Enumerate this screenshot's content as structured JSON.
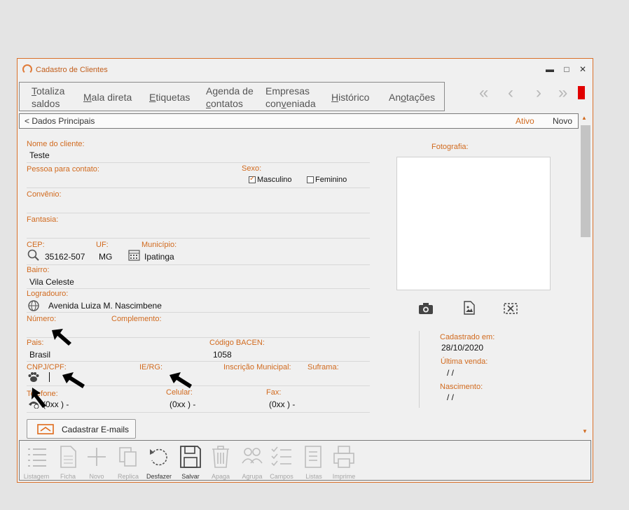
{
  "window": {
    "title": "Cadastro de Clientes",
    "controls": {
      "minimize": "▬",
      "maximize": "□",
      "close": "✕"
    }
  },
  "menu": [
    {
      "line1_pre": "",
      "line1_u": "T",
      "line1_post": "otaliza",
      "line2": "saldos"
    },
    {
      "line1_pre": "",
      "line1_u": "M",
      "line1_post": "ala direta",
      "line2": ""
    },
    {
      "line1_pre": "",
      "line1_u": "E",
      "line1_post": "tiquetas",
      "line2": ""
    },
    {
      "line1": "Agenda de",
      "line2_pre": "",
      "line2_u": "c",
      "line2_post": "ontatos"
    },
    {
      "line1": "Empresas",
      "line2_pre": "con",
      "line2_u": "v",
      "line2_post": "eniada"
    },
    {
      "line1_pre": "",
      "line1_u": "H",
      "line1_post": "istórico",
      "line2": ""
    },
    {
      "line1_pre": "An",
      "line1_u": "o",
      "line1_post": "tações",
      "line2": ""
    }
  ],
  "nav": {
    "first": "«",
    "prev": "‹",
    "next": "›",
    "last": "»",
    "indicator_color": "#e10000"
  },
  "section": {
    "title": "< Dados Principais",
    "status": "Ativo",
    "mode": "Novo"
  },
  "form": {
    "nome_label": "Nome do cliente:",
    "nome_value": "Teste",
    "contato_label": "Pessoa para contato:",
    "sexo_label": "Sexo:",
    "sexo_masculino": "Masculino",
    "sexo_feminino": "Feminino",
    "sexo_selected": "Masculino",
    "convenio_label": "Convênio:",
    "fantasia_label": "Fantasia:",
    "cep_label": "CEP:",
    "cep_value": "35162-507",
    "uf_label": "UF:",
    "uf_value": "MG",
    "municipio_label": "Município:",
    "municipio_value": "Ipatinga",
    "bairro_label": "Bairro:",
    "bairro_value": "Vila Celeste",
    "logradouro_label": "Logradouro:",
    "logradouro_value": "Avenida Luiza M. Nascimbene",
    "numero_label": "Número:",
    "complemento_label": "Complemento:",
    "pais_label": "Pais:",
    "pais_value": "Brasil",
    "bacen_label": "Código BACEN:",
    "bacen_value": "1058",
    "cnpj_label": "CNPJ/CPF:",
    "ie_label": "IE/RG:",
    "inscricao_label": "Inscrição Municipal:",
    "suframa_label": "Suframa:",
    "telefone_label": "Telefone:",
    "telefone_value": "(0xx )   -",
    "celular_label": "Celular:",
    "celular_value": "(0xx )   -",
    "fax_label": "Fax:",
    "fax_value": "(0xx )   -"
  },
  "photo": {
    "label": "Fotografia:"
  },
  "info": {
    "cadastrado_label": "Cadastrado em:",
    "cadastrado_value": "28/10/2020",
    "ultima_venda_label": "Última venda:",
    "ultima_venda_value": "/  /",
    "nascimento_label": "Nascimento:",
    "nascimento_value": "/  /"
  },
  "email_button": {
    "label": "Cadastrar E-mails"
  },
  "toolbar": [
    {
      "name": "listagem",
      "label": "Listagem",
      "active": false
    },
    {
      "name": "ficha",
      "label": "Ficha",
      "active": false
    },
    {
      "name": "novo",
      "label": "Novo",
      "active": false
    },
    {
      "name": "replica",
      "label": "Replica",
      "active": false
    },
    {
      "name": "desfazer",
      "label": "Desfazer",
      "active": true
    },
    {
      "name": "salvar",
      "label": "Salvar",
      "active": true
    },
    {
      "name": "apaga",
      "label": "Apaga",
      "active": false
    },
    {
      "name": "agrupa",
      "label": "Agrupa",
      "active": false
    },
    {
      "name": "campos",
      "label": "Campos",
      "active": false
    },
    {
      "name": "listas",
      "label": "Listas",
      "active": false
    },
    {
      "name": "imprime",
      "label": "Imprime",
      "active": false
    }
  ],
  "colors": {
    "accent": "#d16a1e",
    "border": "#d9702a",
    "indicator": "#e10000"
  }
}
